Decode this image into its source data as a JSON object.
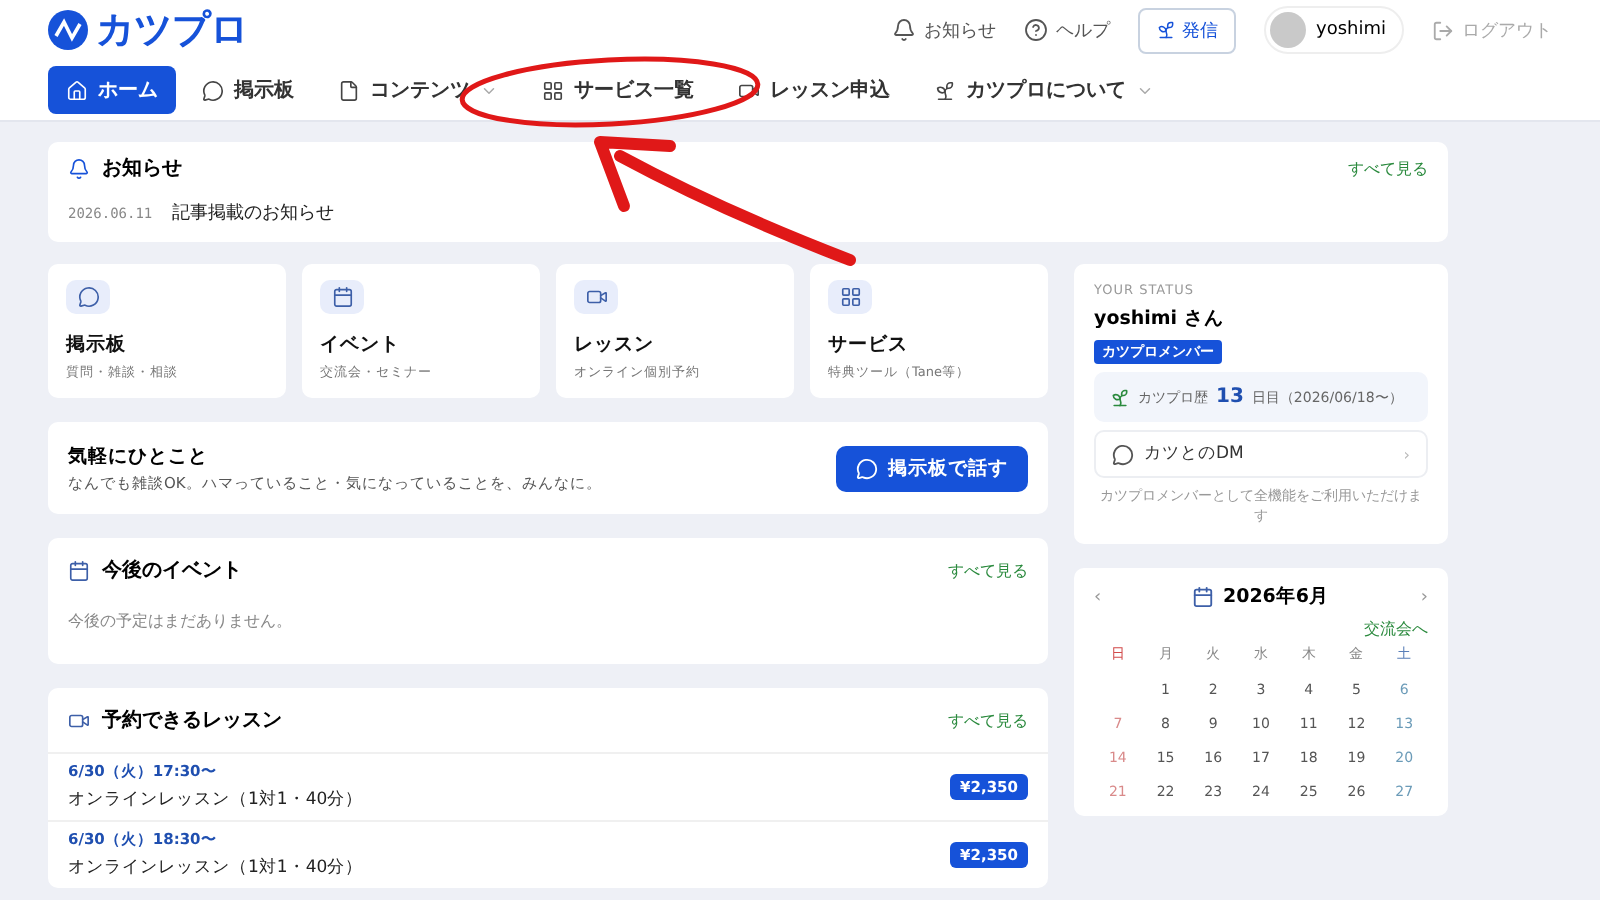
{
  "header": {
    "logo": "カツプロ",
    "actions": [
      {
        "kind": "bell",
        "label": "お知らせ"
      },
      {
        "kind": "help",
        "label": "ヘルプ"
      }
    ],
    "post_button": "発信",
    "user": {
      "name": "yoshimi"
    },
    "logout": "ログアウト"
  },
  "nav": [
    {
      "kind": "home",
      "label": "ホーム",
      "selected": true,
      "dropdown": false
    },
    {
      "kind": "chat",
      "label": "掲示板",
      "selected": false,
      "dropdown": false
    },
    {
      "kind": "file",
      "label": "コンテンツ",
      "selected": false,
      "dropdown": true
    },
    {
      "kind": "grid",
      "label": "サービス一覧",
      "selected": false,
      "dropdown": false
    },
    {
      "kind": "video",
      "label": "レッスン申込",
      "selected": false,
      "dropdown": false
    },
    {
      "kind": "plant",
      "label": "カツプロについて",
      "selected": false,
      "dropdown": true
    }
  ],
  "notice": {
    "title": "お知らせ",
    "see_all": "すべて見る",
    "items": [
      {
        "date": "2026.06.11",
        "text": "記事掲載のお知らせ"
      }
    ]
  },
  "quick_links": [
    {
      "kind": "chat",
      "title": "掲示板",
      "subtitle": "質問・雑談・相談"
    },
    {
      "kind": "calendar",
      "title": "イベント",
      "subtitle": "交流会・セミナー"
    },
    {
      "kind": "video",
      "title": "レッスン",
      "subtitle": "オンライン個別予約"
    },
    {
      "kind": "grid",
      "title": "サービス",
      "subtitle": "特典ツール（Tane等）"
    }
  ],
  "chat_prompt": {
    "title": "気軽にひとこと",
    "text": "なんでも雑談OK。ハマっていること・気になっていることを、みんなに。",
    "button": "掲示板で話す"
  },
  "events": {
    "title": "今後のイベント",
    "see_all": "すべて見る",
    "empty": "今後の予定はまだありません。"
  },
  "lessons": {
    "title": "予約できるレッスン",
    "see_all": "すべて見る",
    "items": [
      {
        "date": "6/30（火）17:30〜",
        "title": "オンラインレッスン（1対1・40分）",
        "price": "¥2,350"
      },
      {
        "date": "6/30（火）18:30〜",
        "title": "オンラインレッスン（1対1・40分）",
        "price": "¥2,350"
      }
    ]
  },
  "status": {
    "label": "YOUR STATUS",
    "name": "yoshimi さん",
    "badge": "カツプロメンバー",
    "tenure_prefix": "カツプロ歴",
    "tenure_days": "13",
    "tenure_suffix": "日目（2026/06/18〜）",
    "dm": "カツとのDM",
    "dm_caret": "›",
    "note": "カツプロメンバーとして全機能をご利用いただけます"
  },
  "calendar": {
    "prev": "‹",
    "next": "›",
    "title": "2026年6月",
    "link": "交流会へ",
    "weekdays": [
      "日",
      "月",
      "火",
      "水",
      "木",
      "金",
      "土"
    ],
    "weeks": [
      [
        "1",
        "2",
        "3",
        "4",
        "5",
        "6"
      ],
      [
        "7",
        "8",
        "9",
        "10",
        "11",
        "12",
        "13"
      ],
      [
        "14",
        "15",
        "16",
        "17",
        "18",
        "19",
        "20"
      ],
      [
        "21",
        "22",
        "23",
        "24",
        "25",
        "26",
        "27"
      ]
    ]
  }
}
